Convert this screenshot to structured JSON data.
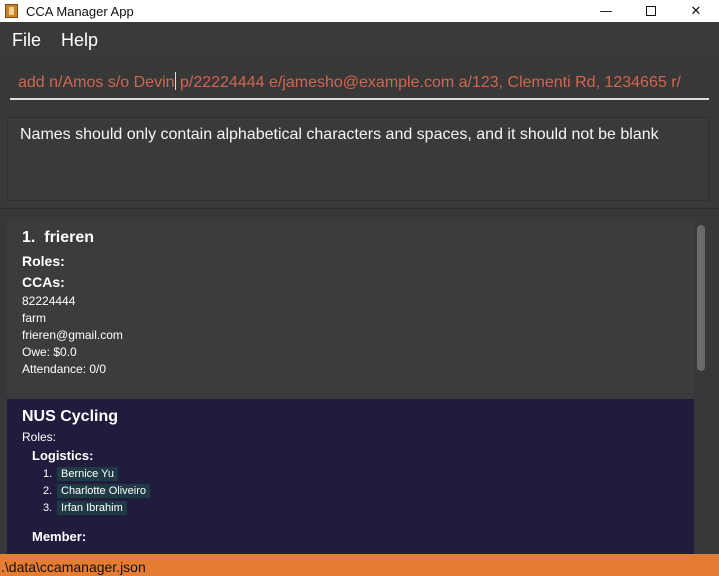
{
  "window": {
    "title": "CCA Manager App",
    "minimize_glyph": "—",
    "close_glyph": "✕"
  },
  "menu": {
    "file": "File",
    "help": "Help"
  },
  "command": {
    "before_caret": "add n/Amos s/o Devin",
    "after_caret": " p/22224444 e/jamesho@example.com a/123, Clementi Rd, 1234665 r/",
    "text_color": "#d06651"
  },
  "result": {
    "message": "Names should only contain alphabetical characters and spaces, and it should not be blank"
  },
  "persons": [
    {
      "index": "1.",
      "name": "frieren",
      "roles_label": "Roles:",
      "ccas_label": "CCAs:",
      "phone": "82224444",
      "address": "farm",
      "email": "frieren@gmail.com",
      "owe": "Owe: $0.0",
      "attendance": "Attendance: 0/0"
    }
  ],
  "ccas": [
    {
      "name": "NUS Cycling",
      "roles_label": "Roles:",
      "role_groups": [
        {
          "label": "Logistics:",
          "members": [
            {
              "num": "1.",
              "name": "Bernice Yu"
            },
            {
              "num": "2.",
              "name": "Charlotte Oliveiro"
            },
            {
              "num": "3.",
              "name": "Irfan Ibrahim"
            }
          ]
        },
        {
          "label": "Member:",
          "members": []
        }
      ]
    }
  ],
  "status": {
    "path": ".\\data\\ccamanager.json",
    "color": "#e57c34"
  }
}
